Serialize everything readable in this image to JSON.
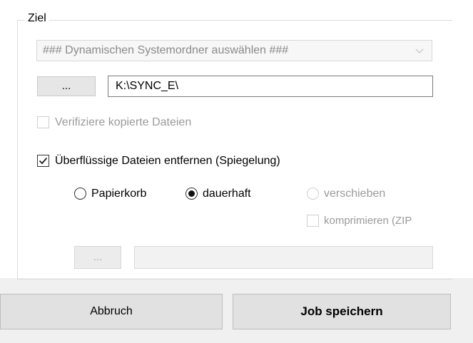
{
  "group": {
    "title": "Ziel"
  },
  "combo": {
    "value": "### Dynamischen Systemordner auswählen ###",
    "icon": "chevron-down-icon"
  },
  "path_row": {
    "browse_label": "...",
    "path_value": "K:\\SYNC_E\\"
  },
  "verify": {
    "label": "Verifiziere kopierte Dateien",
    "checked": false
  },
  "mirror": {
    "label": "Überflüssige Dateien entfernen (Spiegelung)",
    "checked": true
  },
  "delete_mode": {
    "papierkorb": "Papierkorb",
    "dauerhaft": "dauerhaft",
    "verschieben": "verschieben",
    "selected": "dauerhaft"
  },
  "compress": {
    "label": "komprimieren (ZIP",
    "checked": false
  },
  "move_row": {
    "browse_label": "...",
    "path_value": ""
  },
  "footer": {
    "cancel_label": "Abbruch",
    "save_label": "Job speichern"
  }
}
